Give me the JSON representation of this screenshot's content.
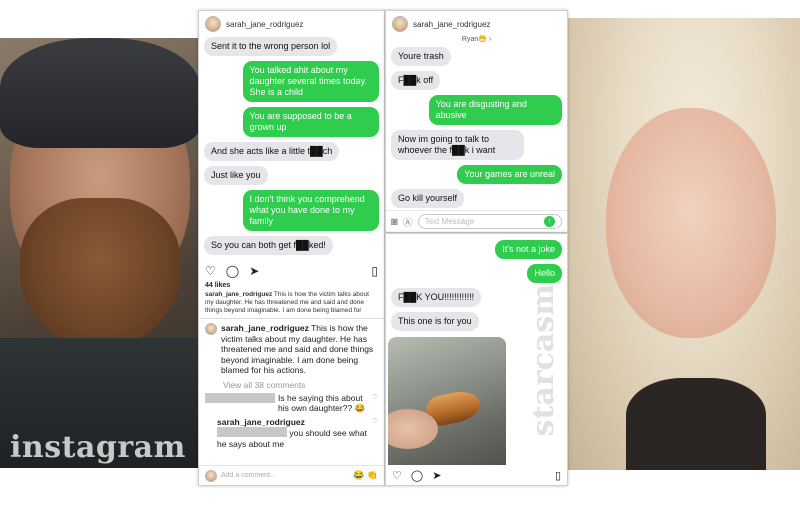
{
  "instagram_watermark": "instagram",
  "starcasm_watermark": "starcasm",
  "panel_a": {
    "username": "sarah_jane_rodriguez",
    "messages": [
      {
        "dir": "in",
        "text": "Sent it to the wrong person lol"
      },
      {
        "dir": "out",
        "text": "You talked ahit about my daughter several times today. She is a child"
      },
      {
        "dir": "out",
        "text": "You are supposed to be a grown up"
      },
      {
        "dir": "in",
        "text": "And she acts like a little t██ch"
      },
      {
        "dir": "in",
        "text": "Just like you"
      },
      {
        "dir": "out",
        "text": "I don't think you comprehend what you have done to my family"
      },
      {
        "dir": "in",
        "text": "So you can both get f██ked!"
      }
    ],
    "likes": "44 likes",
    "caption_user": "sarah_jane_rodriguez",
    "caption_text": "This is how the victim talks about my daughter. He has threatened me and said and done things beyond imaginable. I am done being blamed for",
    "comment_user": "sarah_jane_rodriguez",
    "comment_text": "This is how the victim talks about my daughter. He has threatened me and said and done things beyond imaginable. I am done being blamed for his actions.",
    "view_all": "View all 38 comments",
    "comment1_text": "Is he saying this about his own daughter?? 😂",
    "reply_user": "sarah_jane_rodriguez",
    "reply_text": "you should see what he says about me",
    "add_comment": "Add a comment...",
    "emojis": "😂 👏"
  },
  "panel_b": {
    "username": "sarah_jane_rodriguez",
    "contact": "Ryan😁 ›",
    "messages": [
      {
        "dir": "in",
        "text": "Youre trash"
      },
      {
        "dir": "in",
        "text": "F██k off"
      },
      {
        "dir": "out",
        "text": "You are disgusting and abusive"
      },
      {
        "dir": "in",
        "text": "Now im going to talk to whoever the f██k i want"
      },
      {
        "dir": "out",
        "text": "Your games are unreal"
      },
      {
        "dir": "in",
        "text": "Go kill yourself"
      }
    ],
    "input_placeholder": "Text Message"
  },
  "panel_c": {
    "messages": [
      {
        "dir": "out",
        "text": "It's not a joke"
      },
      {
        "dir": "out",
        "text": "Hello"
      },
      {
        "dir": "in",
        "text": "F██K YOU!!!!!!!!!!!!"
      },
      {
        "dir": "in",
        "text": "This one is for you"
      }
    ]
  }
}
